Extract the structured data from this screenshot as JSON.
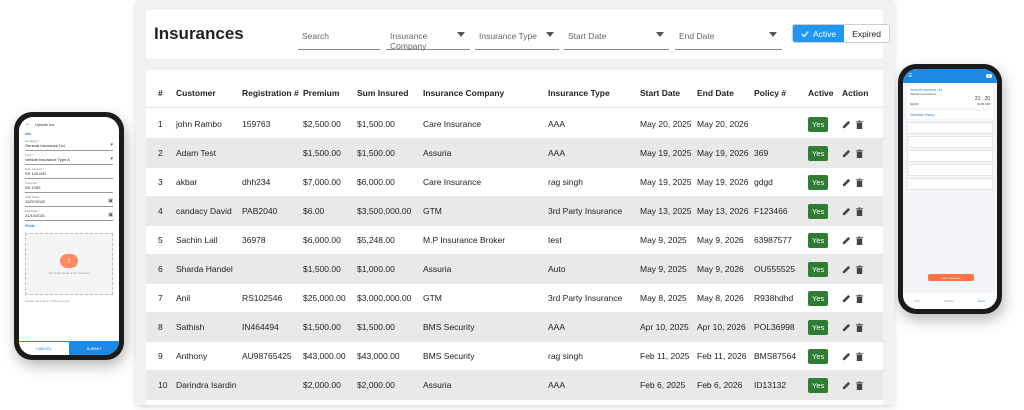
{
  "page": {
    "title": "Insurances"
  },
  "filters": {
    "search_placeholder": "Search",
    "insurance_company": "Insurance Company",
    "insurance_type": "Insurance Type",
    "start_date": "Start Date",
    "end_date": "End Date"
  },
  "status_toggle": {
    "active": "Active",
    "expired": "Expired",
    "selected": "Active"
  },
  "colors": {
    "accent": "#2196f3",
    "yes_badge": "#2e7d32",
    "alt_row": "#e9e9e9",
    "phone_accent": "#1e88e5",
    "phone_cta": "#ff7043"
  },
  "icons": {
    "check": "check-icon",
    "edit": "pencil-icon",
    "delete": "trash-icon"
  },
  "table": {
    "headers": [
      "#",
      "Customer",
      "Registration #",
      "Premium",
      "Sum Insured",
      "Insurance Company",
      "Insurance Type",
      "Start Date",
      "End Date",
      "Policy #",
      "Active",
      "Action"
    ],
    "rows": [
      {
        "no": "1",
        "customer": "john Rambo",
        "registration": "159763",
        "premium": "$2,500.00",
        "sum_insured": "$1,500.00",
        "company": "Care Insurance",
        "type": "AAA",
        "start": "May 20, 2025",
        "end": "May 20, 2026",
        "policy": "",
        "active": "Yes"
      },
      {
        "no": "2",
        "customer": "Adam Test",
        "registration": "",
        "premium": "$1,500.00",
        "sum_insured": "$1,500.00",
        "company": "Assuria",
        "type": "AAA",
        "start": "May 19, 2025",
        "end": "May 19, 2026",
        "policy": "369",
        "active": "Yes"
      },
      {
        "no": "3",
        "customer": "akbar",
        "registration": "dhh234",
        "premium": "$7,000.00",
        "sum_insured": "$6,000.00",
        "company": "Care Insurance",
        "type": "rag singh",
        "start": "May 19, 2025",
        "end": "May 19, 2026",
        "policy": "gdgd",
        "active": "Yes"
      },
      {
        "no": "4",
        "customer": "candacy David",
        "registration": "PAB2040",
        "premium": "$6.00",
        "sum_insured": "$3,500,000.00",
        "company": "GTM",
        "type": "3rd Party Insurance",
        "start": "May 13, 2025",
        "end": "May 13, 2026",
        "policy": "F123466",
        "active": "Yes"
      },
      {
        "no": "5",
        "customer": "Sachin Lall",
        "registration": "36978",
        "premium": "$6,000.00",
        "sum_insured": "$5,248.00",
        "company": "M.P Insurance Broker",
        "type": "test",
        "start": "May 9, 2025",
        "end": "May 9, 2026",
        "policy": "63987577",
        "active": "Yes"
      },
      {
        "no": "6",
        "customer": "Sharda Handel",
        "registration": "",
        "premium": "$1,500.00",
        "sum_insured": "$1,000.00",
        "company": "Assuria",
        "type": "Auto",
        "start": "May 9, 2025",
        "end": "May 9, 2026",
        "policy": "OU555525",
        "active": "Yes"
      },
      {
        "no": "7",
        "customer": "Anil",
        "registration": "RS102546",
        "premium": "$25,000.00",
        "sum_insured": "$3,000,000.00",
        "company": "GTM",
        "type": "3rd Party Insurance",
        "start": "May 8, 2025",
        "end": "May 8, 2026",
        "policy": "R938hdhd",
        "active": "Yes"
      },
      {
        "no": "8",
        "customer": "Sathish",
        "registration": "IN464494",
        "premium": "$1,500.00",
        "sum_insured": "$1,500.00",
        "company": "BMS Security",
        "type": "AAA",
        "start": "Apr 10, 2025",
        "end": "Apr 10, 2026",
        "policy": "POL36998",
        "active": "Yes"
      },
      {
        "no": "9",
        "customer": "Anthony",
        "registration": "AU98765425",
        "premium": "$43,000.00",
        "sum_insured": "$43,000.00",
        "company": "BMS Security",
        "type": "rag singh",
        "start": "Feb 11, 2025",
        "end": "Feb 11, 2026",
        "policy": "BMS87564",
        "active": "Yes"
      },
      {
        "no": "10",
        "customer": "Darindra Isardin",
        "registration": "",
        "premium": "$2,000.00",
        "sum_insured": "$2,000.00",
        "company": "Assuria",
        "type": "AAA",
        "start": "Feb 6, 2025",
        "end": "Feb 6, 2026",
        "policy": "ID13132",
        "active": "Yes"
      }
    ]
  },
  "phone_left": {
    "header": "Update Ins",
    "section": "Info",
    "fields": [
      {
        "label": "Company *",
        "value": "General Insurance Ltd."
      },
      {
        "label": "Type *",
        "value": "Vehicle Insurance Type A"
      },
      {
        "label": "Sum Insured *",
        "value": "SS 120,000"
      },
      {
        "label": "Premium *",
        "value": "SS 1200"
      },
      {
        "label": "Start Date *",
        "value": "12/07/2020"
      },
      {
        "label": "End Date *",
        "value": "21/10/2021"
      }
    ],
    "photo_label": "Photo",
    "photo_hint": "Tap to add photo of the insurance",
    "photo_note": "Please add a photo of the document",
    "cancel": "CANCEL",
    "submit": "SUBMIT"
  },
  "phone_right": {
    "card_title": "General Insurance Ltd.",
    "card_sub": "Vehicle Insurance A",
    "start_day": "21",
    "end_day": "20",
    "amount_a": "$1200",
    "amount_b": "$100,000",
    "list_title": "Insurance History",
    "cta": "Add Insurance",
    "nav": [
      "Info",
      "Policies",
      "Docs"
    ]
  }
}
